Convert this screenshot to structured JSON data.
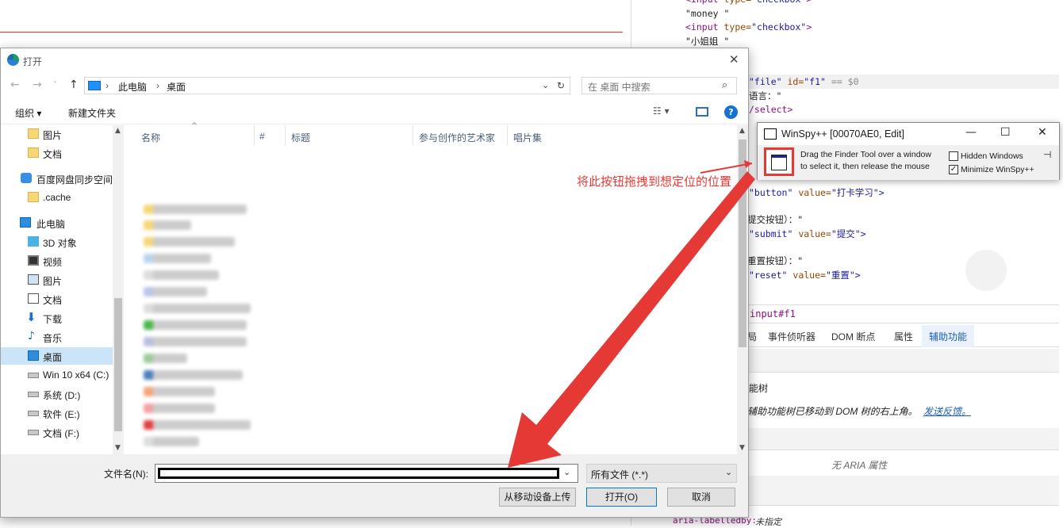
{
  "devtools": {
    "code_lines": [
      {
        "parts": [
          [
            "tag",
            "<input"
          ],
          [
            "attr",
            " type="
          ],
          [
            "val",
            "\"checkbox\""
          ],
          [
            "tag",
            ">"
          ]
        ]
      },
      {
        "parts": [
          [
            "txt",
            "\"money \""
          ]
        ]
      },
      {
        "parts": [
          [
            "tag",
            "<input"
          ],
          [
            "attr",
            " type="
          ],
          [
            "val",
            "\"checkbox\""
          ],
          [
            "tag",
            ">"
          ]
        ]
      },
      {
        "parts": [
          [
            "txt",
            "\"小姐姐 \""
          ]
        ]
      }
    ],
    "sel_line": {
      "val1": "\"file\"",
      "attr": " id=",
      "val2": "\"f1\"",
      "eq": " == $0"
    },
    "line_lang": "语言：\"",
    "line_select": "/select>",
    "line_button": [
      "\"button\"",
      " value=",
      "\"打卡学习\">"
    ],
    "line_submit_label": "提交按钮）：\"",
    "line_submit": [
      "\"submit\"",
      " value=",
      "\"提交\">"
    ],
    "line_reset_label": "重置按钮）：\"",
    "line_reset": [
      "\"reset\"",
      " value=",
      "\"重置\">"
    ],
    "crumb": "input#f1",
    "tabs": [
      "事件侦听器",
      "DOM 断点",
      "属性",
      "辅助功能"
    ],
    "tab_prefix": "局",
    "acc_tree_title": "能树",
    "acc_moved": "辅助功能树已移动到 DOM 树的右上角。",
    "acc_feedback": "发送反馈。",
    "no_aria": "无 ARIA 属性",
    "aria_labelledby": "aria-labelledby:",
    "aria_unset": "未指定"
  },
  "dialog": {
    "title": "打开",
    "address": [
      "此电脑",
      "桌面"
    ],
    "search_placeholder": "在 桌面 中搜索",
    "toolbar": {
      "organize": "组织 ▾",
      "new_folder": "新建文件夹"
    },
    "tree": [
      {
        "label": "图片",
        "icon": "folder-icon"
      },
      {
        "label": "文档",
        "icon": "folder-icon"
      },
      {
        "label": "百度网盘同步空间",
        "icon": "baidu-icon"
      },
      {
        "label": ".cache",
        "icon": "folder-icon"
      },
      {
        "label": "此电脑",
        "icon": "computer-icon"
      },
      {
        "label": "3D 对象",
        "icon": "cube-icon"
      },
      {
        "label": "视频",
        "icon": "video-icon"
      },
      {
        "label": "图片",
        "icon": "picture-icon"
      },
      {
        "label": "文档",
        "icon": "document-icon"
      },
      {
        "label": "下载",
        "icon": "download-icon"
      },
      {
        "label": "音乐",
        "icon": "music-icon"
      },
      {
        "label": "桌面",
        "icon": "desktop-icon",
        "selected": true
      },
      {
        "label": "Win 10 x64 (C:)",
        "icon": "drive-icon"
      },
      {
        "label": "系统 (D:)",
        "icon": "drive-icon"
      },
      {
        "label": "软件 (E:)",
        "icon": "drive-icon"
      },
      {
        "label": "文档 (F:)",
        "icon": "drive-icon"
      }
    ],
    "columns": [
      "名称",
      "#",
      "标题",
      "参与创作的艺术家",
      "唱片集"
    ],
    "filename_label": "文件名(N):",
    "filename_value": "",
    "filetype": "所有文件 (*.*)",
    "buttons": {
      "upload": "从移动设备上传",
      "open": "打开(O)",
      "cancel": "取消"
    }
  },
  "winspy": {
    "title": "WinSpy++ [00070AE0, Edit]",
    "instr_1": "Drag the Finder Tool over a window",
    "instr_2": "to select it, then release the mouse",
    "hidden_windows": "Hidden Windows",
    "minimize": "Minimize WinSpy++",
    "minimize_checked": true,
    "hidden_checked": false
  },
  "annotation": "将此按钮拖拽到想定位的位置",
  "colors": {
    "annotation_red": "#e53935",
    "selection_blue": "#cce4f7",
    "accent_blue": "#1a73e8"
  }
}
